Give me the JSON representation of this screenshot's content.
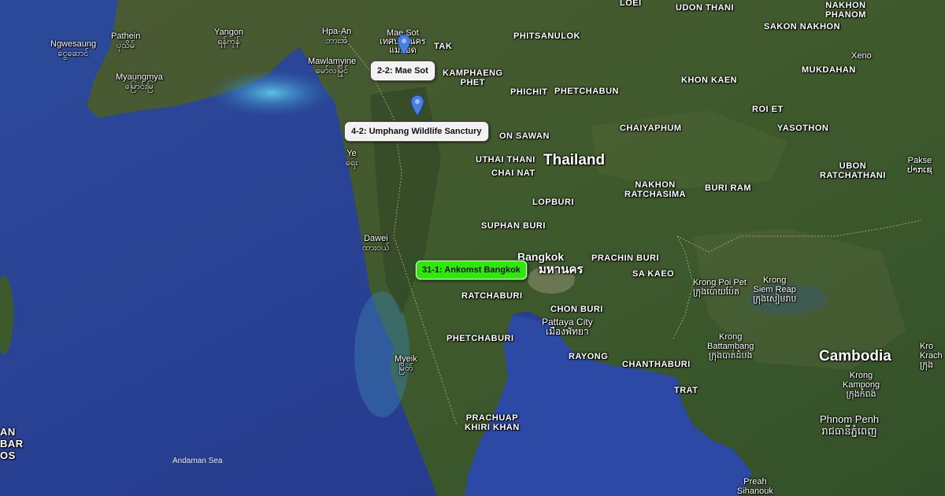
{
  "map": {
    "country_labels": [
      {
        "key": "thailand",
        "text": "Thailand"
      },
      {
        "key": "cambodia",
        "text": "Cambodia"
      }
    ],
    "province_labels": [
      {
        "key": "loei",
        "text": "LOEI"
      },
      {
        "key": "udon_thani",
        "text": "UDON THANI"
      },
      {
        "key": "nakhon_phanom",
        "text": "NAKHON\nPHANOM"
      },
      {
        "key": "sakon_nakhon",
        "text": "SAKON NAKHON"
      },
      {
        "key": "tak",
        "text": "TAK"
      },
      {
        "key": "phitsanulok",
        "text": "PHITSANULOK"
      },
      {
        "key": "kamphaeng_phet",
        "text": "KAMPHAENG\nPHET"
      },
      {
        "key": "khon_kaen",
        "text": "KHON KAEN"
      },
      {
        "key": "mukdahan",
        "text": "MUKDAHAN"
      },
      {
        "key": "phichit",
        "text": "PHICHIT"
      },
      {
        "key": "phetchabun",
        "text": "PHETCHABUN"
      },
      {
        "key": "roi_et",
        "text": "ROI ET"
      },
      {
        "key": "yasothon",
        "text": "YASOTHON"
      },
      {
        "key": "nakhon_sawan",
        "text": "ON SAWAN"
      },
      {
        "key": "chaiyaphum",
        "text": "CHAIYAPHUM"
      },
      {
        "key": "uthai_thani",
        "text": "UTHAI THANI"
      },
      {
        "key": "chai_nat",
        "text": "CHAI NAT"
      },
      {
        "key": "nakhon_ratchasima",
        "text": "NAKHON\nRATCHASIMA"
      },
      {
        "key": "buri_ram",
        "text": "BURI RAM"
      },
      {
        "key": "ubon_ratchathani",
        "text": "UBON\nRATCHATHANI"
      },
      {
        "key": "lopburi",
        "text": "LOPBURI"
      },
      {
        "key": "suphan_buri",
        "text": "SUPHAN BURI"
      },
      {
        "key": "prachin_buri",
        "text": "PRACHIN BURI"
      },
      {
        "key": "sa_kaeo",
        "text": "SA KAEO"
      },
      {
        "key": "ratchaburi",
        "text": "RATCHABURI"
      },
      {
        "key": "chon_buri",
        "text": "CHON BURI"
      },
      {
        "key": "phetchaburi",
        "text": "PHETCHABURI"
      },
      {
        "key": "rayong",
        "text": "RAYONG"
      },
      {
        "key": "chanthaburi",
        "text": "CHANTHABURI"
      },
      {
        "key": "trat",
        "text": "TRAT"
      },
      {
        "key": "prachuap",
        "text": "PRACHUAP\nKHIRI KHAN"
      },
      {
        "key": "nicobar",
        "text": "AN\nBAR\nOS"
      }
    ],
    "city_labels": [
      {
        "key": "pathein",
        "text": "Pathein\nပုသိမ်"
      },
      {
        "key": "yangon",
        "text": "Yangon\nရန်ကုန်"
      },
      {
        "key": "ngwesaung",
        "text": "Ngwesaung\nငွေဆောင်"
      },
      {
        "key": "myaungmya",
        "text": "Myaungmya\nမြောင်းမြ"
      },
      {
        "key": "hpa_an",
        "text": "Hpa-An\nဘားအံ"
      },
      {
        "key": "mawlamyine",
        "text": "Mawlamyine\nမော်လမြိုင်"
      },
      {
        "key": "mae_sot",
        "text": "Mae Sot\nเทศบาลนคร\nแม่สอด"
      },
      {
        "key": "ye",
        "text": "Ye\nရေး"
      },
      {
        "key": "dawei",
        "text": "Dawei\nထားဝယ်"
      },
      {
        "key": "myeik",
        "text": "Myeik\nမြိတ်"
      },
      {
        "key": "xeno",
        "text": "Xeno"
      },
      {
        "key": "pakse",
        "text": "Pakse\nປາກເຊ"
      },
      {
        "key": "kong_poi_pet",
        "text": "Krong Poi Pet\nក្រុងប៉ោយប៉ែត"
      },
      {
        "key": "siem_reap",
        "text": "Krong\nSiem Reap\nក្រុងសៀមរាប"
      },
      {
        "key": "battambang",
        "text": "Krong\nBattambang\nក្រុងបាត់ដំបង"
      },
      {
        "key": "kampong_cham",
        "text": "Krong\nKampong\nក្រុងកំពង់"
      },
      {
        "key": "phnom_penh",
        "text": "Phnom Penh\nរាជធានីភ្នំពេញ"
      },
      {
        "key": "krach",
        "text": "Kro\nKrach\nក្រុង"
      },
      {
        "key": "preah_sihanouk",
        "text": "Preah\nSihanouk"
      },
      {
        "key": "pattaya",
        "text": "Pattaya City\nเมืองพัทยา"
      },
      {
        "key": "pattaya_dummy",
        "text": ""
      }
    ],
    "bangkok": {
      "en": "Bangkok",
      "th": "มหานคร"
    },
    "sea_label": "Andaman Sea",
    "callouts": [
      {
        "key": "mae_sot",
        "text": "2-2: Mae Sot",
        "color": "#f2f2f2"
      },
      {
        "key": "umphang",
        "text": "4-2: Umphang Wildlife Sanctury",
        "color": "#f2f2f2"
      },
      {
        "key": "bangkok",
        "text": "31-1: Ankomst Bangkok",
        "color": "#2ee80c"
      }
    ],
    "pins": [
      {
        "key": "mae_sot_pin",
        "icon": "map-pin-icon",
        "color": "#4a7fe0"
      },
      {
        "key": "umphang_pin",
        "icon": "map-pin-icon",
        "color": "#4a7fe0"
      }
    ]
  }
}
